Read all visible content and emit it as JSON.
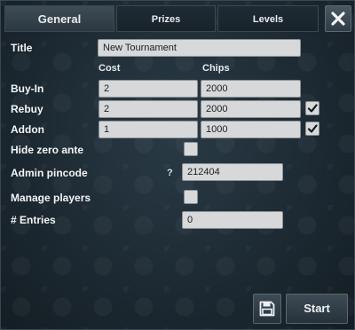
{
  "tabs": [
    {
      "label": "General",
      "active": true
    },
    {
      "label": "Prizes",
      "active": false
    },
    {
      "label": "Levels",
      "active": false
    }
  ],
  "close_icon": "close-icon",
  "form": {
    "title_label": "Title",
    "title_value": "New Tournament",
    "col_cost": "Cost",
    "col_chips": "Chips",
    "buyin_label": "Buy-In",
    "buyin_cost": "2",
    "buyin_chips": "2000",
    "rebuy_label": "Rebuy",
    "rebuy_cost": "2",
    "rebuy_chips": "2000",
    "rebuy_checked": true,
    "addon_label": "Addon",
    "addon_cost": "1",
    "addon_chips": "1000",
    "addon_checked": true,
    "hide_zero_ante_label": "Hide zero ante",
    "hide_zero_ante_checked": false,
    "admin_pincode_label": "Admin pincode",
    "admin_pincode_help": "?",
    "admin_pincode_value": "212404",
    "manage_players_label": "Manage players",
    "manage_players_checked": false,
    "entries_label": "# Entries",
    "entries_value": "0"
  },
  "actions": {
    "save_icon": "save-icon",
    "start_label": "Start"
  },
  "colors": {
    "background": "#1d2a33",
    "field": "#d6d8da",
    "text": "#f2f4f5"
  }
}
